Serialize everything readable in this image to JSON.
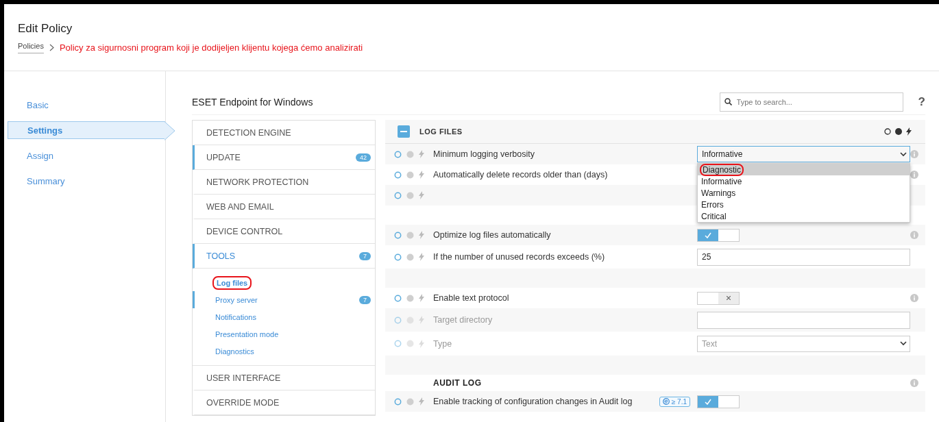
{
  "header": {
    "title": "Edit Policy",
    "breadcrumb": {
      "link": "Policies",
      "current": "Policy za sigurnosni program koji je dodijeljen klijentu kojega ćemo analizirati"
    }
  },
  "nav": [
    {
      "label": "Basic",
      "selected": false
    },
    {
      "label": "Settings",
      "selected": true
    },
    {
      "label": "Assign",
      "selected": false
    },
    {
      "label": "Summary",
      "selected": false
    }
  ],
  "product": "ESET Endpoint for Windows",
  "search": {
    "placeholder": "Type to search..."
  },
  "help": "?",
  "menu": [
    {
      "label": "DETECTION ENGINE",
      "modified": false,
      "selected": false
    },
    {
      "label": "UPDATE",
      "modified": true,
      "selected": false,
      "count": "42"
    },
    {
      "label": "NETWORK PROTECTION",
      "modified": false,
      "selected": false
    },
    {
      "label": "WEB AND EMAIL",
      "modified": false,
      "selected": false
    },
    {
      "label": "DEVICE CONTROL",
      "modified": false,
      "selected": false
    },
    {
      "label": "TOOLS",
      "modified": true,
      "selected": true,
      "count": "7",
      "children": [
        {
          "label": "Log files",
          "selected": true,
          "modified": false,
          "annotated": true
        },
        {
          "label": "Proxy server",
          "selected": false,
          "modified": true,
          "count": "7",
          "annotated": false
        },
        {
          "label": "Notifications",
          "selected": false,
          "modified": false,
          "annotated": false
        },
        {
          "label": "Presentation mode",
          "selected": false,
          "modified": false,
          "annotated": false
        },
        {
          "label": "Diagnostics",
          "selected": false,
          "modified": false,
          "annotated": false
        }
      ]
    },
    {
      "label": "USER INTERFACE",
      "modified": false,
      "selected": false
    },
    {
      "label": "OVERRIDE MODE",
      "modified": false,
      "selected": false
    }
  ],
  "section": {
    "title": "LOG FILES",
    "expanded": true,
    "rows": [
      {
        "kind": "select",
        "label": "Minimum logging verbosity",
        "value": "Informative",
        "disabled": false,
        "info": true,
        "open": true,
        "options": [
          {
            "label": "Diagnostic",
            "highlighted": true,
            "annotated": true
          },
          {
            "label": "Informative",
            "highlighted": false,
            "annotated": false
          },
          {
            "label": "Warnings",
            "highlighted": false,
            "annotated": false
          },
          {
            "label": "Errors",
            "highlighted": false,
            "annotated": false
          },
          {
            "label": "Critical",
            "highlighted": false,
            "annotated": false
          }
        ]
      },
      {
        "kind": "covered",
        "label": "Automatically delete records older than (days)",
        "disabled": false,
        "info": true
      },
      {
        "kind": "covered",
        "label": "",
        "disabled": false,
        "info": false
      },
      {
        "kind": "spacer"
      },
      {
        "kind": "toggle",
        "label": "Optimize log files automatically",
        "on": true,
        "disabled": false,
        "info": true
      },
      {
        "kind": "input",
        "label": "If the number of unused records exceeds (%)",
        "value": "25",
        "disabled": false,
        "info": false
      },
      {
        "kind": "spacer"
      },
      {
        "kind": "toggle",
        "label": "Enable text protocol",
        "on": false,
        "disabled": false,
        "info": true
      },
      {
        "kind": "input",
        "label": "Target directory",
        "value": "",
        "disabled": true,
        "info": false
      },
      {
        "kind": "select",
        "label": "Type",
        "value": "Text",
        "disabled": true,
        "info": false,
        "open": false
      },
      {
        "kind": "spacer"
      },
      {
        "kind": "heading",
        "label": "AUDIT LOG",
        "info": true
      },
      {
        "kind": "toggle",
        "label": "Enable tracking of configuration changes in Audit log",
        "on": true,
        "disabled": false,
        "info": false,
        "badge": "≥ 7.1"
      }
    ]
  }
}
